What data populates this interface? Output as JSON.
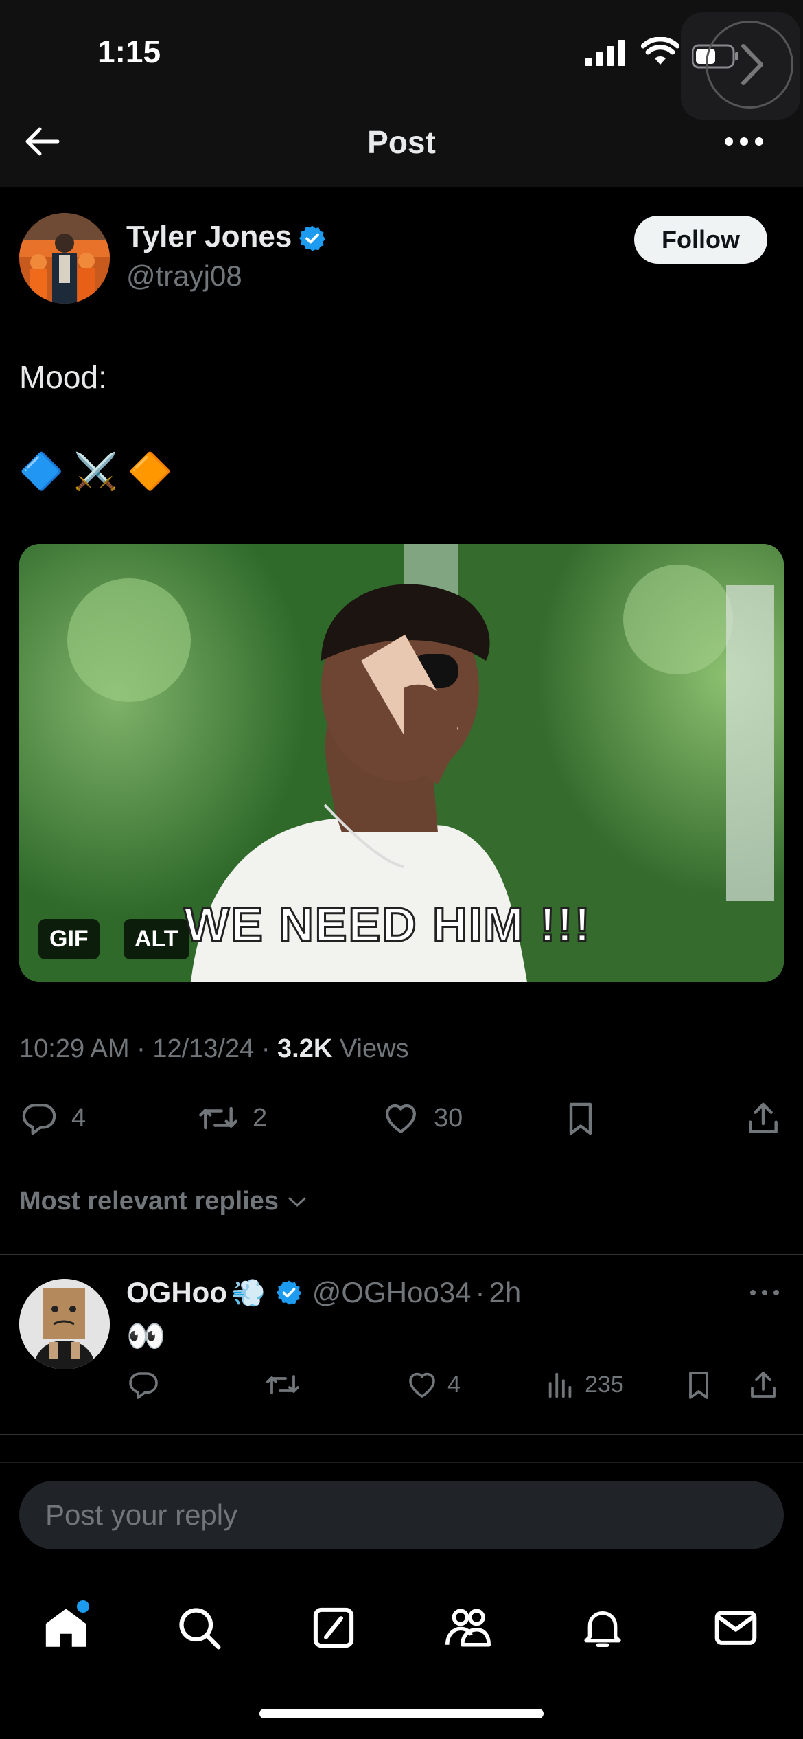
{
  "status_bar": {
    "time": "1:15"
  },
  "header": {
    "title": "Post"
  },
  "author": {
    "name": "Tyler Jones",
    "handle": "@trayj08",
    "follow_label": "Follow"
  },
  "tweet": {
    "text_line1": "Mood:",
    "emoji_line": "🔷 ⚔️ 🔶",
    "media_badges": [
      "GIF",
      "ALT"
    ],
    "gif_caption": "WE NEED HIM !!!"
  },
  "meta": {
    "time": "10:29 AM",
    "date": "12/13/24",
    "views_count": "3.2K",
    "views_label": "Views"
  },
  "actions": {
    "replies": "4",
    "reposts": "2",
    "likes": "30"
  },
  "replies_sort": {
    "label": "Most relevant replies"
  },
  "reply": {
    "name": "OGHoo",
    "name_emoji": "💨",
    "handle": "@OGHoo34",
    "age": "2h",
    "text": "👀",
    "likes": "4",
    "views": "235"
  },
  "composer": {
    "placeholder": "Post your reply"
  },
  "colors": {
    "verified": "#1d9bf0",
    "notification_dot": "#1d9bf0"
  },
  "nav": [
    "home-icon",
    "search-icon",
    "grok-icon",
    "communities-icon",
    "notifications-icon",
    "messages-icon"
  ]
}
